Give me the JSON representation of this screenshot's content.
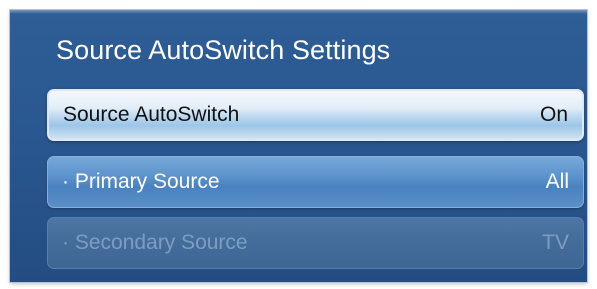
{
  "dialog": {
    "title": "Source AutoSwitch Settings",
    "items": [
      {
        "label": "Source AutoSwitch",
        "value": "On",
        "state": "selected"
      },
      {
        "label": "· Primary Source",
        "value": "All",
        "state": "enabled"
      },
      {
        "label": "· Secondary Source",
        "value": "TV",
        "state": "disabled"
      }
    ]
  },
  "colors": {
    "panel_background": "#2a5790",
    "selected_highlight": "#b9d6ee",
    "enabled_item": "#5b92cb",
    "disabled_item": "#446c9b",
    "disabled_text": "#7e9dc0"
  }
}
